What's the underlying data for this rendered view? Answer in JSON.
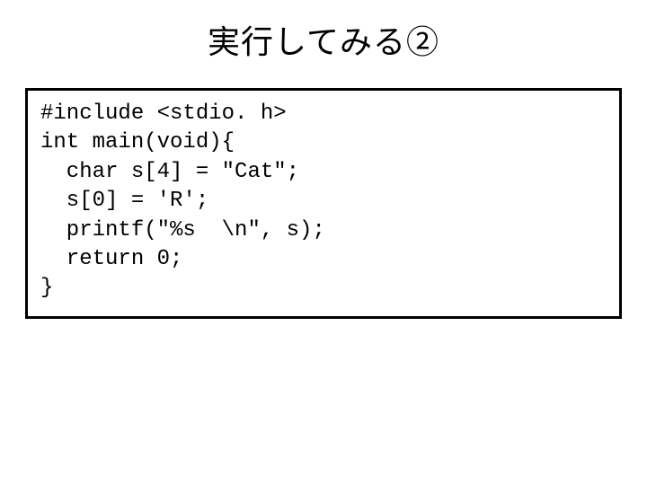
{
  "title": "実行してみる②",
  "code": {
    "l1": "#include <stdio. h>",
    "l2": "int main(void){",
    "l3": "  char s[4] = \"Cat\";",
    "l4": "  s[0] = 'R';",
    "l5": "  printf(\"%s  \\n\", s);",
    "l6": "  return 0;",
    "l7": "}"
  }
}
